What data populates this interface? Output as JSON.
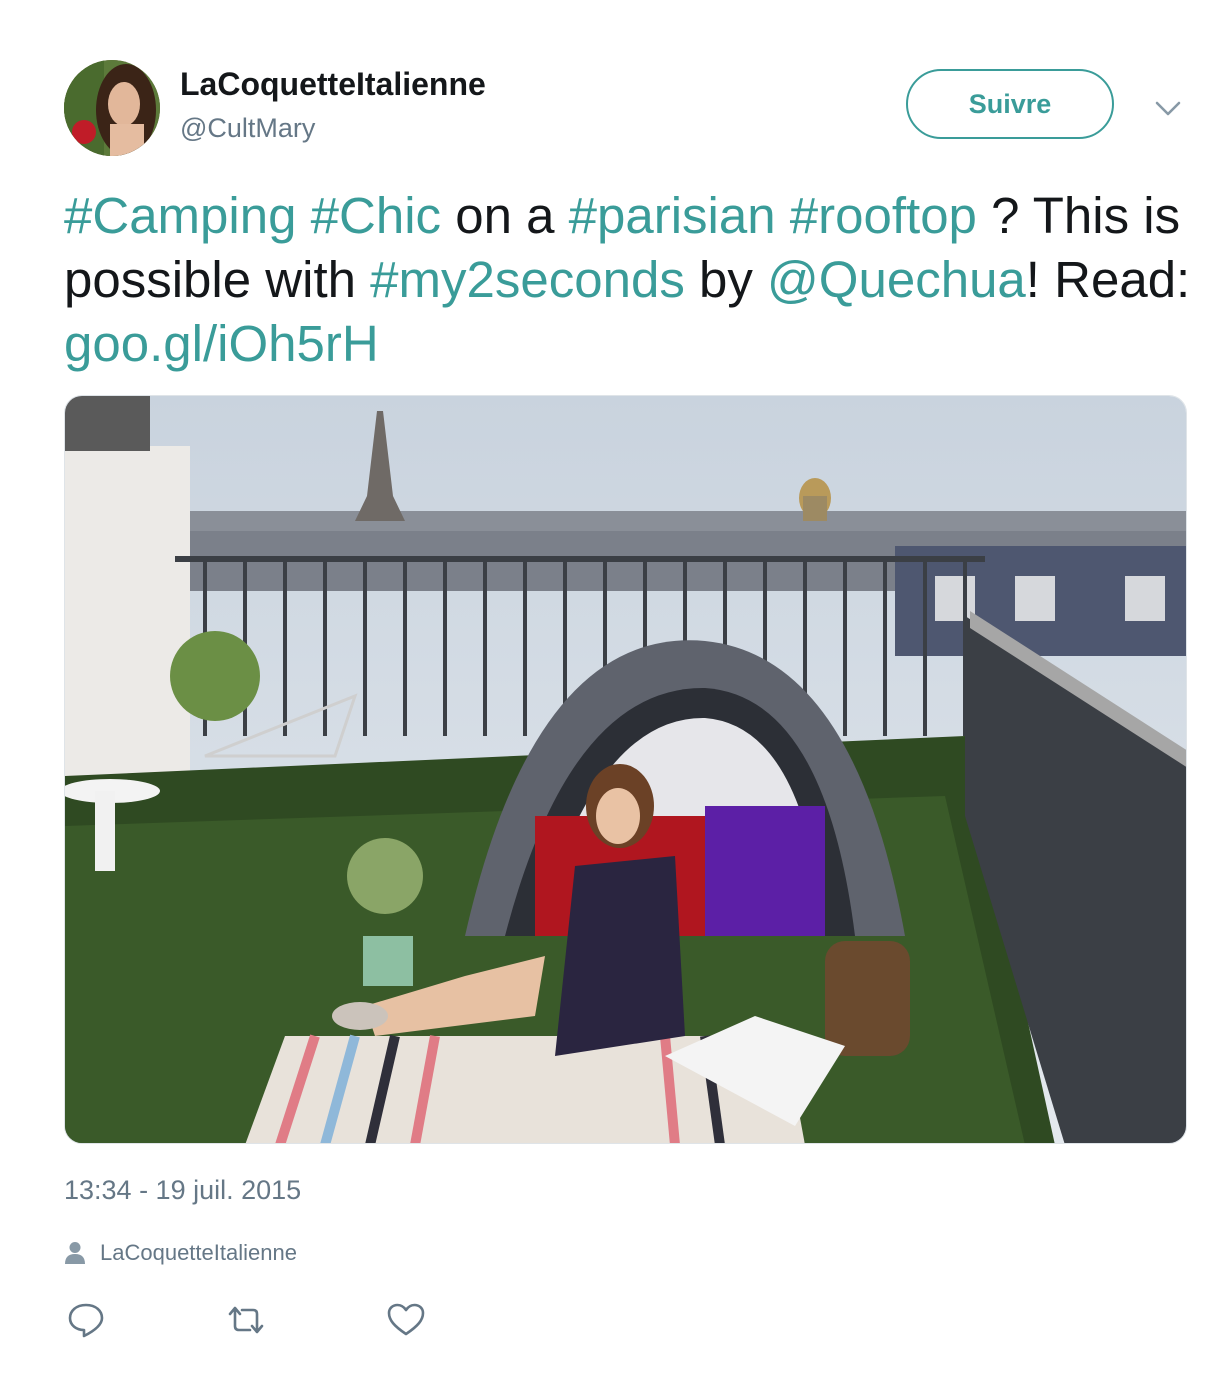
{
  "author": {
    "display_name": "LaCoquetteItalienne",
    "handle": "@CultMary",
    "avatar_icon": "profile-photo"
  },
  "header": {
    "follow_label": "Suivre",
    "more_icon": "chevron-down-icon"
  },
  "tweet": {
    "segments": [
      {
        "text": "#Camping",
        "link": true
      },
      {
        "text": " ",
        "link": false
      },
      {
        "text": "#Chic",
        "link": true
      },
      {
        "text": " on a ",
        "link": false
      },
      {
        "text": "#parisian",
        "link": true
      },
      {
        "text": " ",
        "link": false
      },
      {
        "text": "#rooftop",
        "link": true
      },
      {
        "text": " ? This is possible with ",
        "link": false
      },
      {
        "text": "#my2seconds",
        "link": true
      },
      {
        "text": " by ",
        "link": false
      },
      {
        "text": "@Quechua",
        "link": true
      },
      {
        "text": "! Read: ",
        "link": false
      },
      {
        "text": "goo.gl/iOh5rH",
        "link": true
      }
    ]
  },
  "media": {
    "kind": "photo"
  },
  "meta": {
    "timestamp": "13:34 - 19 juil. 2015",
    "via_label": "LaCoquetteItalienne"
  },
  "actions": {
    "reply_icon": "reply-icon",
    "retweet_icon": "retweet-icon",
    "like_icon": "heart-icon"
  },
  "colors": {
    "accent": "#3a9c99",
    "text": "#14171a",
    "muted": "#657786"
  }
}
